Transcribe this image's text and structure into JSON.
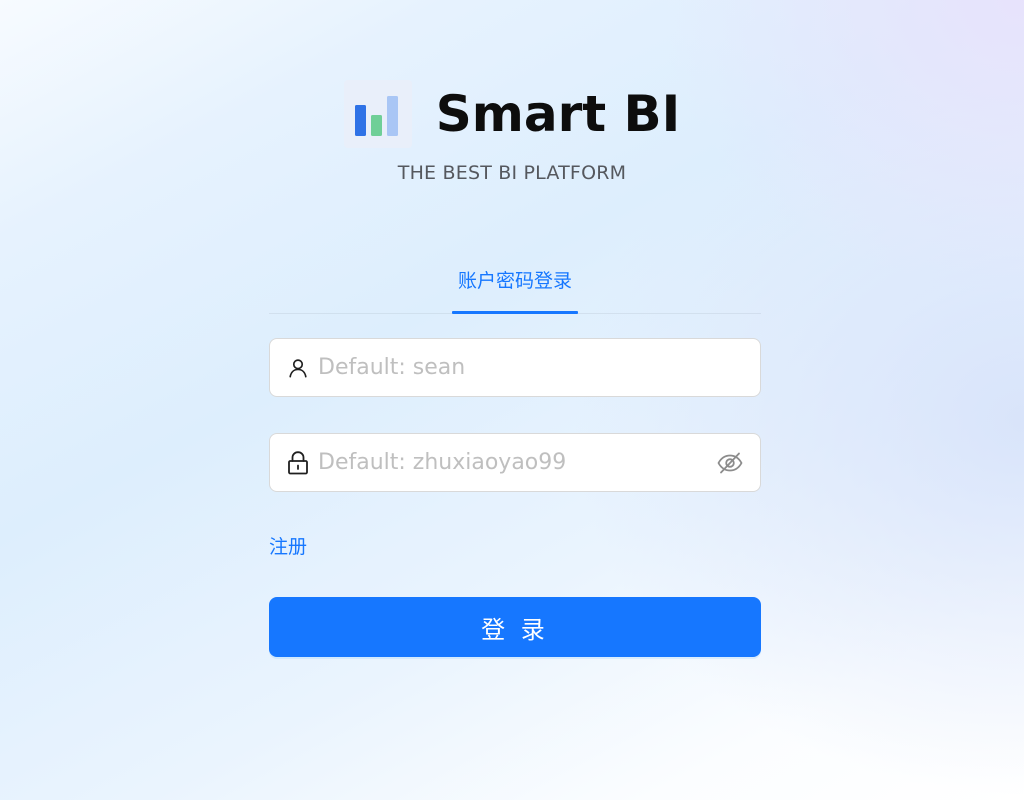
{
  "header": {
    "logo_icon": "bar-chart-logo",
    "title": "Smart BI",
    "subtitle": "THE BEST BI PLATFORM"
  },
  "tabs": [
    {
      "label": "账户密码登录",
      "active": true
    }
  ],
  "form": {
    "username": {
      "icon": "user-icon",
      "placeholder": "Default: sean",
      "value": ""
    },
    "password": {
      "icon": "lock-icon",
      "placeholder": "Default: zhuxiaoyao99",
      "value": "",
      "toggle_icon": "eye-invisible-icon"
    },
    "register_label": "注册",
    "submit_label": "登 录"
  },
  "colors": {
    "primary": "#1677ff",
    "title": "#0d0d0d",
    "subtitle": "#55585e",
    "placeholder": "#bfbfbf",
    "logo_bg": "#e9effa",
    "logo_bar_blue": "#2f72e6",
    "logo_bar_green": "#6fcf97",
    "logo_bar_light": "#a9c6f5"
  }
}
